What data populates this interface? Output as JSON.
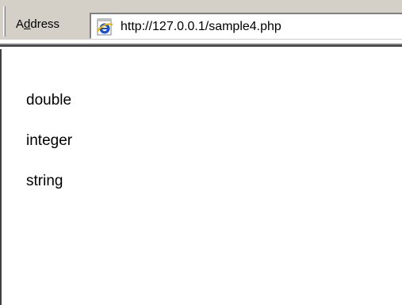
{
  "address_bar": {
    "label_prefix": "A",
    "label_accel": "d",
    "label_suffix": "dress",
    "url": "http://127.0.0.1/sample4.php",
    "page_icon": "ie-page-icon"
  },
  "page": {
    "lines": [
      "double",
      "integer",
      "string"
    ]
  },
  "colors": {
    "chrome": "#d4d0c8",
    "border_dark": "#808080",
    "border_darker": "#404040",
    "icon_blue": "#1a4fd0"
  }
}
